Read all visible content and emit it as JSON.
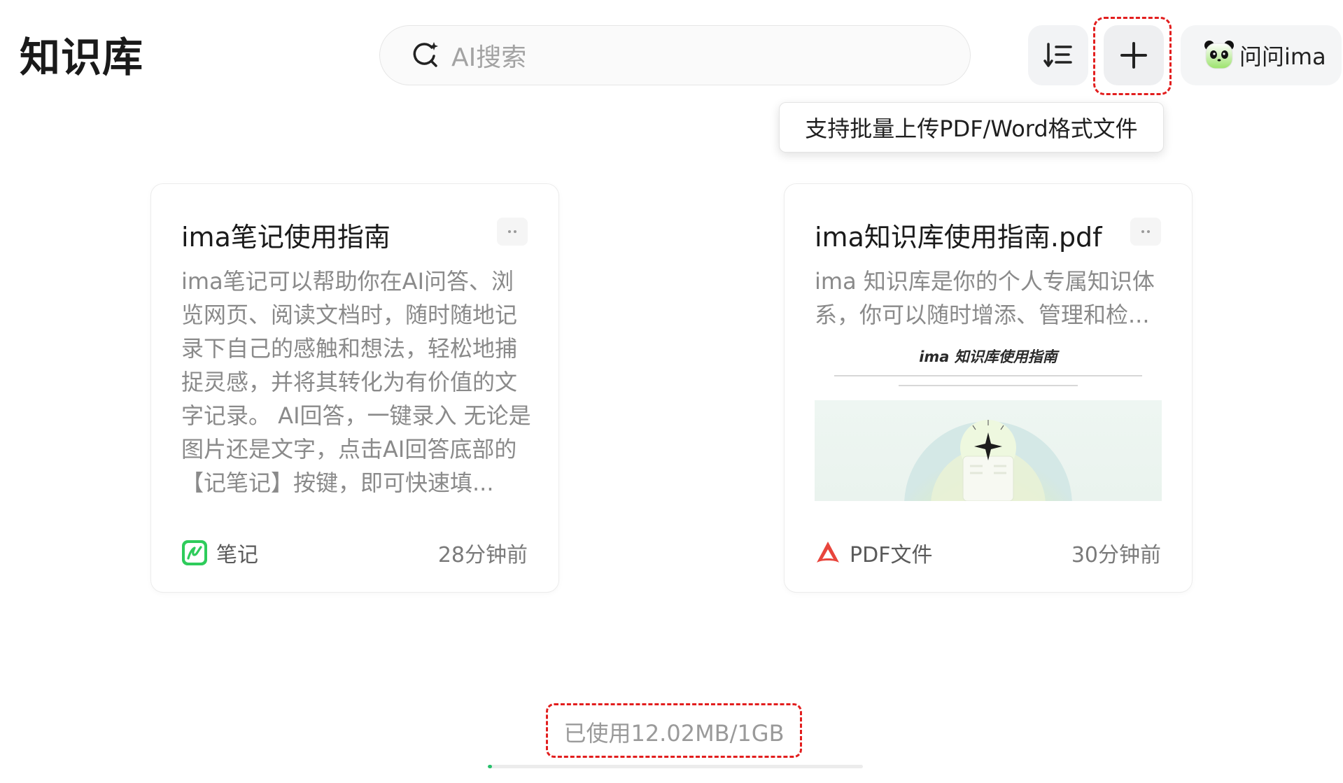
{
  "header": {
    "title": "知识库",
    "search_placeholder": "AI搜索",
    "ask_label": "问问ima"
  },
  "tooltip": {
    "text": "支持批量上传PDF/Word格式文件"
  },
  "cards": [
    {
      "title": "ima笔记使用指南",
      "description": "ima笔记可以帮助你在AI问答、浏览网页、阅读文档时，随时随地记录下自己的感触和想法，轻松地捕捉灵感，并将其转化为有价值的文字记录。 AI回答，一键录入 无论是图片还是文字，点击AI回答底部的【记笔记】按键，即可快速填...",
      "type_label": "笔记",
      "time": "28分钟前",
      "icon": "note-icon",
      "icon_color": "#2ecc5b"
    },
    {
      "title": "ima知识库使用指南.pdf",
      "description": "ima 知识库是你的个人专属知识体系，你可以随时增添、管理和检...",
      "preview_title": "ima 知识库使用指南",
      "type_label": "PDF文件",
      "time": "30分钟前",
      "icon": "pdf-icon",
      "icon_color": "#e8453c"
    }
  ],
  "storage": {
    "text": "已使用12.02MB/1GB",
    "used_fraction": 0.012,
    "bar_color": "#27c06b"
  }
}
